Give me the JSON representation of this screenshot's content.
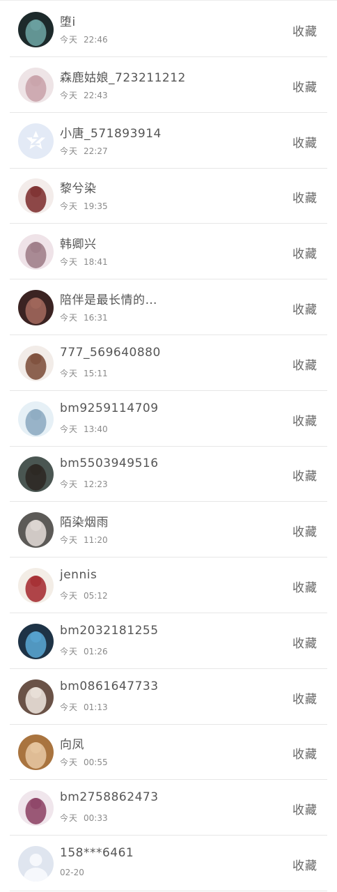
{
  "favorite_label": "收藏",
  "contacts": [
    {
      "name": "堕i",
      "day": "今天",
      "time": "22:46",
      "avatar": "avatar-photo",
      "bg": "#1d2a2b",
      "fg": "#6fa7a6"
    },
    {
      "name": "森鹿姑娘_723211212",
      "day": "今天",
      "time": "22:43",
      "avatar": "avatar-photo",
      "bg": "#eee4e6",
      "fg": "#c8a1a8"
    },
    {
      "name": "小唐_571893914",
      "day": "今天",
      "time": "22:27",
      "avatar": "qq-logo-avatar",
      "bg": "#e3eaf6",
      "fg": "#ffffff"
    },
    {
      "name": "黎兮染",
      "day": "今天",
      "time": "19:35",
      "avatar": "avatar-photo",
      "bg": "#f3ecea",
      "fg": "#7a2a2a"
    },
    {
      "name": "韩卿兴",
      "day": "今天",
      "time": "18:41",
      "avatar": "avatar-photo",
      "bg": "#efe3e8",
      "fg": "#9c7a85"
    },
    {
      "name": "陪伴是最长情的…",
      "day": "今天",
      "time": "16:31",
      "avatar": "avatar-photo",
      "bg": "#3b2322",
      "fg": "#a66a5e"
    },
    {
      "name": "777_569640880",
      "day": "今天",
      "time": "15:11",
      "avatar": "avatar-photo",
      "bg": "#f2ece8",
      "fg": "#7a4a35"
    },
    {
      "name": "bm9259114709",
      "day": "今天",
      "time": "13:40",
      "avatar": "avatar-photo",
      "bg": "#e6f0f6",
      "fg": "#8aa8c0"
    },
    {
      "name": "bm5503949516",
      "day": "今天",
      "time": "12:23",
      "avatar": "avatar-photo",
      "bg": "#4a5652",
      "fg": "#2b2622"
    },
    {
      "name": "陌染烟雨",
      "day": "今天",
      "time": "11:20",
      "avatar": "avatar-photo",
      "bg": "#5c5a57",
      "fg": "#e4ddd8"
    },
    {
      "name": "jennis",
      "day": "今天",
      "time": "05:12",
      "avatar": "avatar-photo",
      "bg": "#f3ede6",
      "fg": "#a2262c"
    },
    {
      "name": "bm2032181255",
      "day": "今天",
      "time": "01:26",
      "avatar": "avatar-photo",
      "bg": "#1e3346",
      "fg": "#5aa9d6"
    },
    {
      "name": "bm0861647733",
      "day": "今天",
      "time": "01:13",
      "avatar": "avatar-photo",
      "bg": "#6a5247",
      "fg": "#f0e7e1"
    },
    {
      "name": "向凤",
      "day": "今天",
      "time": "00:55",
      "avatar": "avatar-photo",
      "bg": "#a9743f",
      "fg": "#e9c9a4"
    },
    {
      "name": "bm2758862473",
      "day": "今天",
      "time": "00:33",
      "avatar": "avatar-photo",
      "bg": "#f0e6ec",
      "fg": "#8b3e62"
    },
    {
      "name": "158***6461",
      "day": "",
      "time": "02-20",
      "avatar": "default-avatar",
      "bg": "#dfe5ef",
      "fg": "#f6f8fc"
    }
  ]
}
